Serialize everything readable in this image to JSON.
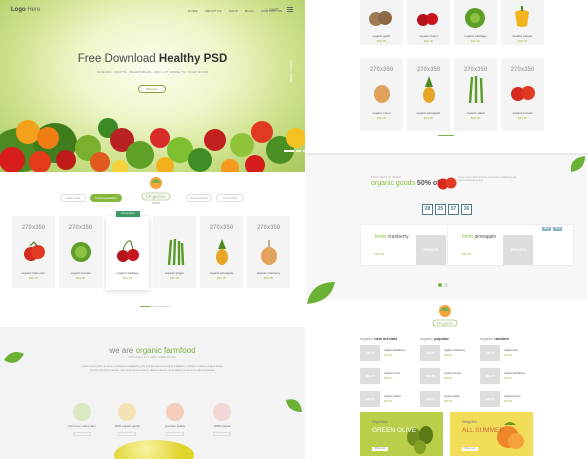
{
  "header": {
    "logo_main": "Logo",
    "logo_sub": "Here",
    "nav": [
      "HOME",
      "ABOUT US",
      "SHOP",
      "BLOG",
      "CONTACT US"
    ],
    "cart": "CART"
  },
  "hero": {
    "title_prefix": "Free Download ",
    "title_bold": "Healthy PSD",
    "subtitle": "ORGANIC FRUITS, VEGETABLES, AND LOT MORE TO YOUR DOOR",
    "button": "Discover",
    "side_text": "SCROLL DOWN"
  },
  "tabs": [
    "Fresh fruits",
    "Fresh vegetables",
    "Juice & drinks",
    "Fresh meat"
  ],
  "brand": {
    "name": "Organic",
    "tag": "FRESH"
  },
  "products": [
    {
      "dim": "270x350",
      "name": "organic hello corn",
      "price": "$20.00"
    },
    {
      "dim": "270x350",
      "name": "organic tomato",
      "price": "$24.00"
    },
    {
      "dim": "",
      "name": "organic cabbage",
      "price": "$20.00",
      "hot": "Hot product"
    },
    {
      "dim": "",
      "name": "organic ginger",
      "price": "$20.00"
    },
    {
      "dim": "270x350",
      "name": "organic pineapple",
      "price": "$20.00"
    },
    {
      "dim": "270x350",
      "name": "organic cranberry",
      "price": "$20.00"
    }
  ],
  "about": {
    "title_prefix": "we are ",
    "title_bold": "organic farmfood",
    "subtitle": "ORGANIC NATURE FARMHOUSE",
    "text": "Lorem ipsum dolor sit amet, consectetur adipisicing elit, sed do eiusmod tempor incididunt ut labore et dolore magna aliqua. Ut enim ad minim veniam, quis nostrud exercitation ullamco laboris nisi ut aliquip ex ea commodo consequat.",
    "features": [
      "fresh from nature farm",
      "100% organic goods",
      "premium quality",
      "100% natural"
    ]
  },
  "right_top": [
    {
      "name": "organic garlic",
      "price": "$20.00"
    },
    {
      "name": "organic cherry",
      "price": "$20.00"
    },
    {
      "name": "organic cabbage",
      "price": "$20.00"
    },
    {
      "name": "healthy pepper",
      "price": "$20.00"
    }
  ],
  "right_grid": [
    {
      "dim": "270x350",
      "name": "organic onion",
      "price": "$20.00"
    },
    {
      "dim": "270x350",
      "name": "organic pineapple",
      "price": "$20.00"
    },
    {
      "dim": "270x350",
      "name": "organic salad",
      "price": "$20.00"
    },
    {
      "dim": "270x350",
      "name": "organic tomato",
      "price": "$20.00"
    }
  ],
  "offer": {
    "small": "ENJOY BEST OF OFFER",
    "title_prefix": "organic goods ",
    "title_bold": "50% off",
    "text": "Lorem ipsum dolor sit amet, consectetur adipisicing elit, sed do eiusmod tempor.",
    "countdown": [
      "28",
      "25",
      "57",
      "36"
    ]
  },
  "deals": [
    {
      "title_a": "fresh ",
      "title_b": "cranberry",
      "price": "$20.00",
      "img": "200x270",
      "tags": [
        "NEW",
        "SALE"
      ]
    },
    {
      "title_a": "fresh ",
      "title_b": "pineapple",
      "price": "$20.00",
      "img": "200x270",
      "tags": [
        "NEW",
        "SALE"
      ]
    }
  ],
  "columns": [
    {
      "title_a": "organic ",
      "title_b": "new arrivals",
      "items": [
        "organic blackberry",
        "organic carrot",
        "organic dollars"
      ]
    },
    {
      "title_a": "organic ",
      "title_b": "popular",
      "items": [
        "organic strawberry",
        "organic tomato",
        "organic apple"
      ]
    },
    {
      "title_a": "organic ",
      "title_b": "random",
      "items": [
        "organic kiwi",
        "organic blackberry",
        "organic lemon"
      ]
    }
  ],
  "mini_img": "100x75",
  "mini_price": "$20.00",
  "banners": [
    {
      "top": "Vegetable",
      "main": "GREEN OLIVE",
      "btn": "Shop now",
      "bg": "#b9cf4a"
    },
    {
      "top": "Delightful",
      "main": "ALL SUMMER",
      "btn": "Shop now",
      "bg": "#f2dd58"
    }
  ],
  "colors": {
    "green": "#86b73c",
    "teal": "#4f7c8c"
  }
}
